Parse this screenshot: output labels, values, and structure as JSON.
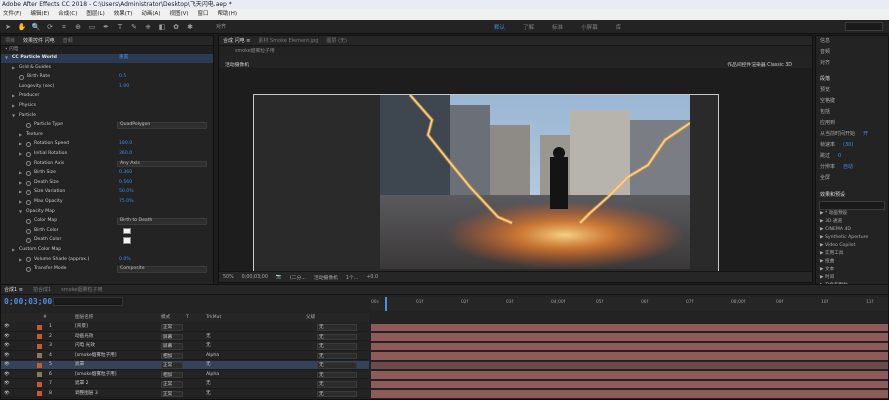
{
  "window": {
    "title": "Adobe After Effects CC 2018 - C:\\Users\\Administrator\\Desktop\\飞天闪电.aep *"
  },
  "menu": [
    "文件(F)",
    "编辑(E)",
    "合成(C)",
    "图层(L)",
    "效果(T)",
    "动画(A)",
    "视图(V)",
    "窗口",
    "帮助(H)"
  ],
  "toolbar": {
    "workspaces": [
      "默认",
      "了解",
      "标准",
      "小屏幕",
      "库"
    ],
    "active_workspace": "默认",
    "checkbox_label": "对齐"
  },
  "effects_panel": {
    "tabs": [
      "项目",
      "效果控件 闪电",
      "音频"
    ],
    "sub": "• 闪电",
    "rows": [
      {
        "ind": 0,
        "arrow": "▼",
        "name": "CC Particle World",
        "value": "重置",
        "kind": "fx"
      },
      {
        "ind": 1,
        "arrow": "▶",
        "name": "Grid & Guides"
      },
      {
        "ind": 1,
        "sw": true,
        "name": "Birth Rate",
        "value": "0.5"
      },
      {
        "ind": 1,
        "name": "Longevity (sec)",
        "value": "1.00"
      },
      {
        "ind": 1,
        "arrow": "▶",
        "name": "Producer"
      },
      {
        "ind": 1,
        "arrow": "▶",
        "name": "Physics"
      },
      {
        "ind": 1,
        "arrow": "▼",
        "name": "Particle"
      },
      {
        "ind": 2,
        "sw": true,
        "name": "Particle Type",
        "dropdown": "QuadPolygon"
      },
      {
        "ind": 2,
        "arrow": "▶",
        "name": "Texture"
      },
      {
        "ind": 2,
        "arrow": "▶",
        "sw": true,
        "name": "Rotation Speed",
        "value": "180.0"
      },
      {
        "ind": 2,
        "arrow": "▶",
        "sw": true,
        "name": "Initial Rotation",
        "value": "360.0"
      },
      {
        "ind": 2,
        "sw": true,
        "name": "Rotation Axis",
        "dropdown": "Any Axis"
      },
      {
        "ind": 2,
        "arrow": "▶",
        "sw": true,
        "name": "Birth Size",
        "value": "0.360"
      },
      {
        "ind": 2,
        "arrow": "▶",
        "sw": true,
        "name": "Death Size",
        "value": "0.560"
      },
      {
        "ind": 2,
        "arrow": "▶",
        "sw": true,
        "name": "Size Variation",
        "value": "50.0%"
      },
      {
        "ind": 2,
        "arrow": "▶",
        "sw": true,
        "name": "Max Opacity",
        "value": "75.0%"
      },
      {
        "ind": 2,
        "arrow": "▼",
        "name": "Opacity Map"
      },
      {
        "ind": 2,
        "sw": true,
        "name": "Color Map",
        "dropdown": "Birth to Death"
      },
      {
        "ind": 2,
        "sw": true,
        "name": "Birth Color",
        "swatch": true
      },
      {
        "ind": 2,
        "sw": true,
        "name": "Death Color",
        "swatch": true
      },
      {
        "ind": 1,
        "arrow": "▶",
        "name": "Custom Color Map"
      },
      {
        "ind": 2,
        "arrow": "▶",
        "sw": true,
        "name": "Volume Shade (approx.)",
        "value": "0.0%"
      },
      {
        "ind": 2,
        "sw": true,
        "name": "Transfer Mode",
        "dropdown": "Composite"
      }
    ]
  },
  "comp_panel": {
    "tabs": [
      "合成 闪电 ≡",
      "素材 Smoke Element.jpg"
    ],
    "layer_tab": "图层 (无)",
    "subtab": "smoke烟雾粒子用",
    "view_label": "活动摄像机",
    "renderer": "作品间控件渲染器 Classic 3D",
    "zoom": "50%",
    "time": "0;00;03;00",
    "resolution": "(二分...",
    "camera": "活动摄像机",
    "view_count": "1个...",
    "exposure": "+0.0"
  },
  "right_panel": {
    "top": [
      "信息",
      "音频"
    ],
    "align_label": "对齐",
    "heading": "段落",
    "rows": [
      {
        "k": "预览",
        "v": ""
      },
      {
        "k": "空格键",
        "v": ""
      },
      {
        "k": "包括",
        "v": ""
      },
      {
        "k": "应用到",
        "v": ""
      },
      {
        "k": "从当前时间开始",
        "v": "开"
      },
      {
        "k": "帧速率",
        "v": "(30)"
      },
      {
        "k": "跳过",
        "v": "0"
      },
      {
        "k": "分辨率",
        "v": "自动"
      },
      {
        "k": "全屏",
        "v": ""
      }
    ],
    "effects_heading": "效果和预设",
    "effects_list": [
      "▶ * 动画预设",
      "▶ 3D 通道",
      "▶ CINEMA 4D",
      "▶ Synthetic Aperture",
      "▶ Video Copilot",
      "▶ 实用工具",
      "▶ 扭曲",
      "▶ 文本",
      "▶ 时间",
      "▶ 杂色和颗粒"
    ]
  },
  "timeline": {
    "tabs": [
      "合成1 ≡",
      "拍合成1",
      "smoke烟雾粒子用"
    ],
    "timecode": "0;00;03;00",
    "ruler": [
      "00s",
      "01f",
      "02f",
      "03f",
      "04;00f",
      "05f",
      "06f",
      "07f",
      "08;00f",
      "09f",
      "10f",
      "11f"
    ],
    "columns": [
      "#",
      "图层名称",
      "模式",
      "T",
      "TrkMat",
      "父级"
    ],
    "layers": [
      {
        "num": "1",
        "name": "[背景]",
        "mode": "正常",
        "trk": "",
        "parent": "无",
        "color": "#c65a33"
      },
      {
        "num": "2",
        "name": "动画光效",
        "mode": "屏幕",
        "trk": "无",
        "parent": "无",
        "color": "#c65a33"
      },
      {
        "num": "3",
        "name": "闪电 光效",
        "mode": "屏幕",
        "trk": "无",
        "parent": "无",
        "color": "#c65a33"
      },
      {
        "num": "4",
        "name": "[smoke烟雾粒子用]",
        "mode": "相加",
        "trk": "Alpha",
        "parent": "无",
        "color": "#8a7a5a"
      },
      {
        "num": "5",
        "name": "遮罩",
        "mode": "正常",
        "trk": "无",
        "parent": "无",
        "color": "#c65a33"
      },
      {
        "num": "6",
        "name": "[smoke烟雾粒子用]",
        "mode": "相加",
        "trk": "Alpha",
        "parent": "无",
        "color": "#8a7a5a"
      },
      {
        "num": "7",
        "name": "遮罩 2",
        "mode": "正常",
        "trk": "无",
        "parent": "无",
        "color": "#c65a33"
      },
      {
        "num": "8",
        "name": "调整图层 3",
        "mode": "正常",
        "trk": "无",
        "parent": "无",
        "color": "#c65a33"
      }
    ]
  }
}
